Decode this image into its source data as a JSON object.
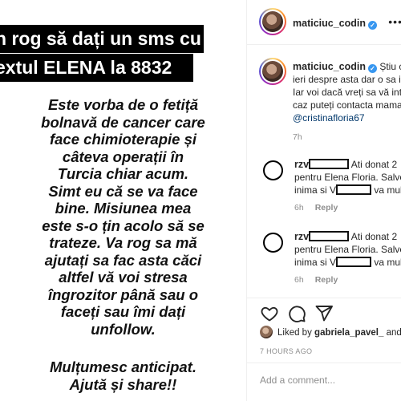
{
  "story": {
    "highlight_line1": "n rog să dați un sms cu",
    "highlight_line2": "extul ELENA la 8832",
    "body_lines": [
      "Este vorba de o fetiță",
      "bolnavă de cancer care",
      "face chimioterapie și",
      "câteva operații în",
      "Turcia chiar acum.",
      "Simt eu că se va face",
      "bine. Misiunea mea",
      "este s-o țin acolo să se",
      "trateze. Va rog sa mă",
      "ajutați sa fac asta căci",
      "altfel vă voi stresa",
      "îngrozitor până sau o",
      "faceți sau îmi dați",
      "unfollow."
    ],
    "thanks_lines": [
      "Mulțumesc anticipat.",
      "Ajută și share!!"
    ]
  },
  "header": {
    "username": "maticiuc_codin",
    "verified": "✓",
    "more": "•••"
  },
  "caption": {
    "username": "maticiuc_codin",
    "lines": [
      "Știu că",
      "ieri despre asta dar o sa in",
      "Iar voi dacă vreți sa vă inte",
      "caz puteți contacta mama"
    ],
    "mention": "@cristinafloria67",
    "time": "7h"
  },
  "comments": [
    {
      "username": "rzv",
      "line1": "Ati donat 2",
      "line2": "pentru Elena Floria. Salvea",
      "line3a": "inima si V",
      "line3b": "va mult",
      "time": "6h",
      "reply": "Reply"
    },
    {
      "username": "rzv",
      "line1": "Ati donat 2",
      "line2": "pentru Elena Floria. Salvea",
      "line3a": "inima si V",
      "line3b": "va mult",
      "time": "6h",
      "reply": "Reply"
    }
  ],
  "likes": {
    "prefix": "Liked by",
    "user": "gabriela_pavel_",
    "suffix": "and"
  },
  "post_time": "7 HOURS AGO",
  "add_comment": {
    "placeholder": "Add a comment..."
  },
  "icons": [
    "heart-icon",
    "comment-icon",
    "share-icon"
  ],
  "colors": {
    "verified": "#3897f0",
    "mention": "#00376b",
    "muted": "#8e8e8e"
  }
}
